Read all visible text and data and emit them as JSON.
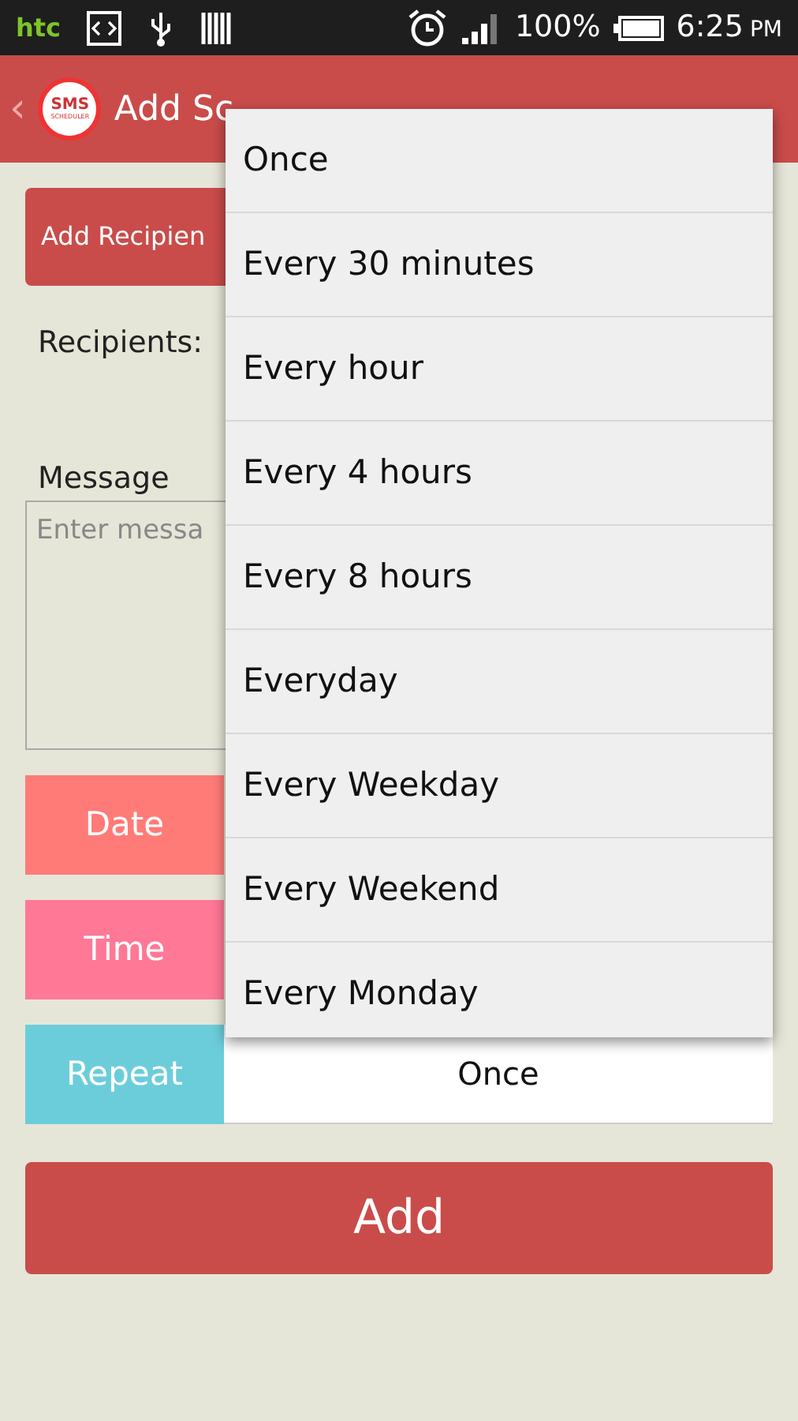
{
  "status_bar": {
    "brand": "htc",
    "battery": "100%",
    "time": "6:25",
    "ampm": "PM"
  },
  "app_bar": {
    "back": "‹",
    "title": "Add Sc",
    "logo_top": "SMS",
    "logo_bottom": "SCHEDULER"
  },
  "form": {
    "add_recipient": "Add Recipien",
    "recipients_label": "Recipients:",
    "message_label": "Message",
    "message_placeholder": "Enter messa",
    "rows": [
      {
        "label": "Date",
        "color": "#ff7b78"
      },
      {
        "label": "Time",
        "color": "#ff7896"
      },
      {
        "label": "Repeat",
        "color": "#6ccdda",
        "value": "Once"
      }
    ],
    "submit": "Add"
  },
  "menu": {
    "items": [
      "Once",
      "Every 30 minutes",
      "Every hour",
      "Every 4 hours",
      "Every 8 hours",
      "Everyday",
      "Every Weekday",
      "Every Weekend",
      "Every Monday"
    ]
  }
}
